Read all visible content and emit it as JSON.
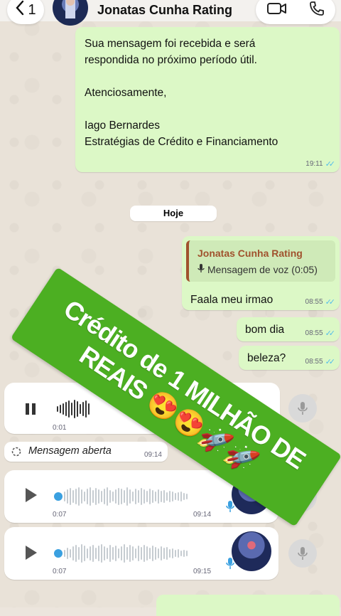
{
  "header": {
    "back_label": "1",
    "title": "Jonatas Cunha Rating",
    "icons": [
      "chevron-left-icon",
      "video-call-icon",
      "phone-icon"
    ]
  },
  "messages": {
    "auto_reply": {
      "text": "Sua mensagem foi recebida e será\nrespondida no próximo período útil.\n\nAtenciosamente,\n\nIago Bernardes\nEstratégias de Crédito e Financiamento",
      "time": "19:11"
    },
    "date_divider": "Hoje",
    "reply": {
      "quote_name": "Jonatas Cunha Rating",
      "quote_text": "Mensagem de voz (0:05)",
      "text": "Faala meu irmao",
      "time": "08:55"
    },
    "bom_dia": {
      "text": "bom dia",
      "time": "08:55"
    },
    "beleza": {
      "text": "beleza?",
      "time": "08:55"
    }
  },
  "recording": {
    "duration": "0:01"
  },
  "status": {
    "text": "Mensagem aberta",
    "time": "09:14"
  },
  "voice_notes": [
    {
      "duration": "0:07",
      "time": "09:14"
    },
    {
      "duration": "0:07",
      "time": "09:15"
    }
  ],
  "banner": {
    "line1": "Crédito de 1 MILHÃO DE",
    "line2": "REAIS 😍😍🚀🚀",
    "color": "#4caf22"
  },
  "colors": {
    "outgoing_bubble": "#dcf8c6",
    "incoming_bubble": "#ffffff",
    "read_check": "#53bdeb",
    "quote_accent": "#a0522d"
  }
}
